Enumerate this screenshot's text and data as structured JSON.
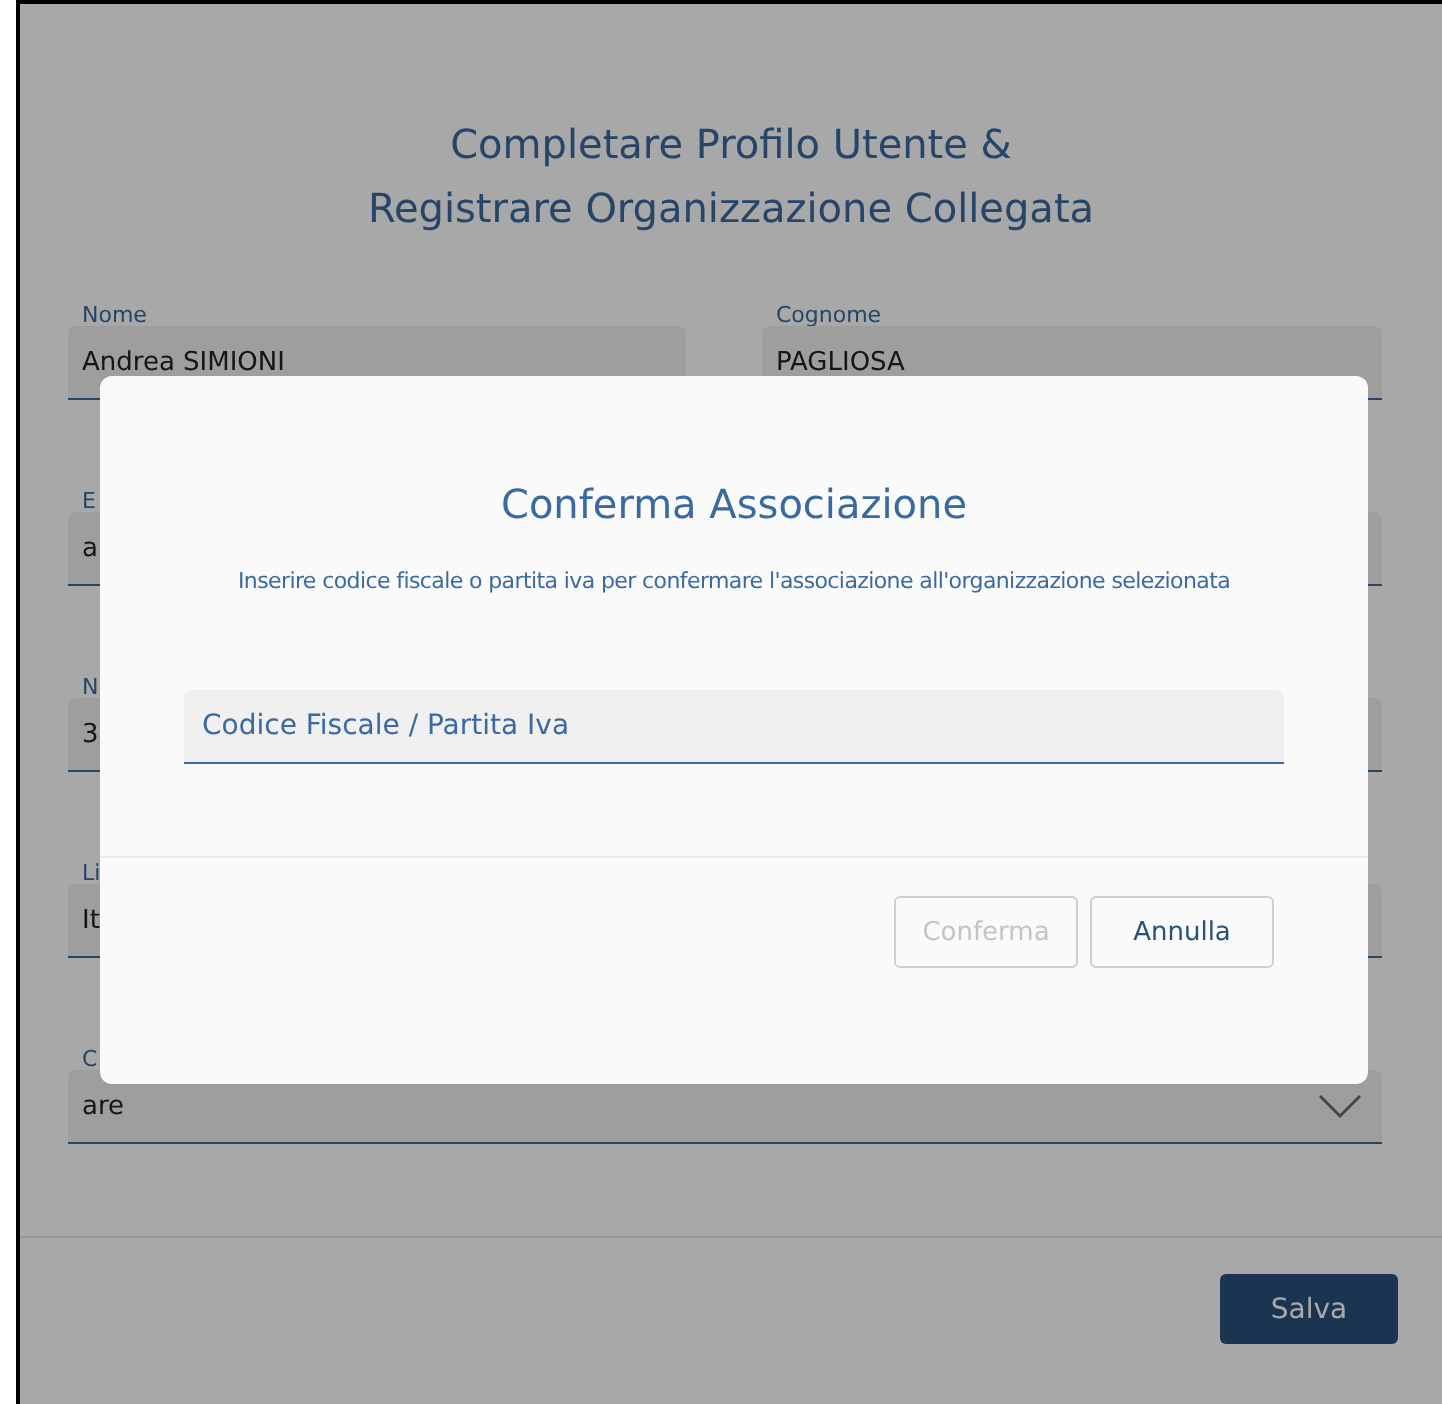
{
  "page": {
    "title_lines": [
      "Completare Profilo Utente &",
      "Registrare Organizzazione Collegata"
    ],
    "rows": [
      {
        "fields": [
          {
            "label": "Nome",
            "value": "Andrea SIMIONI"
          },
          {
            "label": "Cognome",
            "value": "PAGLIOSA"
          }
        ]
      },
      {
        "fields": [
          {
            "label": "E",
            "value": "a",
            "kind": "input"
          },
          {
            "kind": "input"
          }
        ]
      },
      {
        "fields": [
          {
            "label": "N",
            "value": "3",
            "kind": "input"
          },
          {
            "kind": "input"
          }
        ]
      },
      {
        "fields": [
          {
            "label": "Li",
            "value": "It",
            "kind": "input"
          },
          {
            "kind": "input"
          }
        ]
      },
      {
        "fields": [
          {
            "label": "C",
            "value": "are",
            "kind": "dropdown"
          }
        ]
      }
    ],
    "save_button": "Salva"
  },
  "dialog": {
    "title": "Conferma Associazione",
    "message": "Inserire codice fiscale o partita iva per confermare l'associazione all'organizzazione selezionata",
    "input": {
      "placeholder": "Codice Fiscale / Partita Iva"
    },
    "buttons": [
      {
        "label": "Conferma",
        "disabled": true
      },
      {
        "label": "Annulla",
        "disabled": false
      }
    ]
  }
}
